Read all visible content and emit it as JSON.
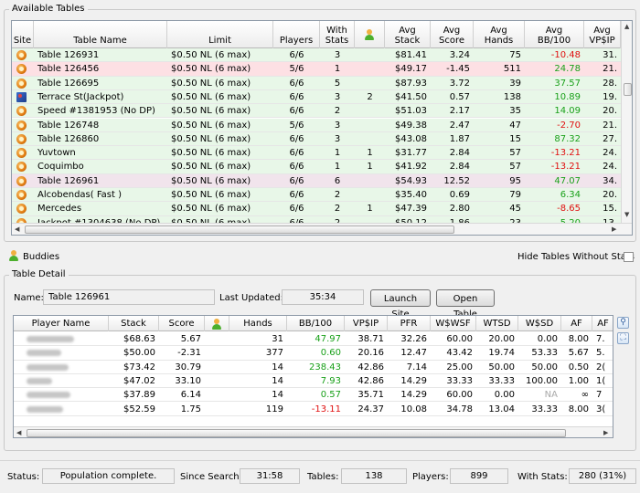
{
  "available_tables": {
    "title": "Available Tables",
    "columns": [
      "Site",
      "Table Name",
      "Limit",
      "Players",
      "With\nStats",
      "",
      "Avg\nStack",
      "Avg\nScore",
      "Avg\nHands",
      "Avg\nBB/100",
      "Avg\nVP$IP"
    ],
    "rows": [
      {
        "site_icon": "site-orange-icon",
        "name": "Table  126931",
        "limit": "$0.50 NL (6 max)",
        "players": "6/6",
        "with_stats": "3",
        "buddies": "",
        "avg_stack": "$81.41",
        "avg_score": "3.24",
        "avg_hands": "75",
        "avg_bb100": "-10.48",
        "bb_color": "red",
        "avg_vpip": "31.",
        "bg": "#e8f7e8"
      },
      {
        "site_icon": "site-orange-icon",
        "name": "Table  126456",
        "limit": "$0.50 NL (6 max)",
        "players": "5/6",
        "with_stats": "1",
        "buddies": "",
        "avg_stack": "$49.17",
        "avg_score": "-1.45",
        "avg_hands": "511",
        "avg_bb100": "24.78",
        "bb_color": "green",
        "avg_vpip": "21.",
        "bg": "#fde0e4"
      },
      {
        "site_icon": "site-orange-icon",
        "name": "Table  126695",
        "limit": "$0.50 NL (6 max)",
        "players": "6/6",
        "with_stats": "5",
        "buddies": "",
        "avg_stack": "$87.93",
        "avg_score": "3.72",
        "avg_hands": "39",
        "avg_bb100": "37.57",
        "bb_color": "green",
        "avg_vpip": "28.",
        "bg": "#e8f7e8"
      },
      {
        "site_icon": "site-blue-icon",
        "name": "Terrace St(Jackpot)",
        "limit": "$0.50 NL (6 max)",
        "players": "6/6",
        "with_stats": "3",
        "buddies": "2",
        "avg_stack": "$41.50",
        "avg_score": "0.57",
        "avg_hands": "138",
        "avg_bb100": "10.89",
        "bb_color": "green",
        "avg_vpip": "19.",
        "bg": "#e8f7e8"
      },
      {
        "site_icon": "site-orange-icon",
        "name": "Speed #1381953 (No DP)",
        "limit": "$0.50 NL (6 max)",
        "players": "6/6",
        "with_stats": "2",
        "buddies": "",
        "avg_stack": "$51.03",
        "avg_score": "2.17",
        "avg_hands": "35",
        "avg_bb100": "14.09",
        "bb_color": "green",
        "avg_vpip": "20.",
        "bg": "#e8f7e8"
      },
      {
        "site_icon": "site-orange-icon",
        "name": "Table  126748",
        "limit": "$0.50 NL (6 max)",
        "players": "5/6",
        "with_stats": "3",
        "buddies": "",
        "avg_stack": "$49.38",
        "avg_score": "2.47",
        "avg_hands": "47",
        "avg_bb100": "-2.70",
        "bb_color": "red",
        "avg_vpip": "21.",
        "bg": "#e8f7e8"
      },
      {
        "site_icon": "site-orange-icon",
        "name": "Table  126860",
        "limit": "$0.50 NL (6 max)",
        "players": "6/6",
        "with_stats": "3",
        "buddies": "",
        "avg_stack": "$43.08",
        "avg_score": "1.87",
        "avg_hands": "15",
        "avg_bb100": "87.32",
        "bb_color": "green",
        "avg_vpip": "27.",
        "bg": "#e8f7e8"
      },
      {
        "site_icon": "site-orange-icon",
        "name": "Yuvtown",
        "limit": "$0.50 NL (6 max)",
        "players": "6/6",
        "with_stats": "1",
        "buddies": "1",
        "avg_stack": "$31.77",
        "avg_score": "2.84",
        "avg_hands": "57",
        "avg_bb100": "-13.21",
        "bb_color": "red",
        "avg_vpip": "24.",
        "bg": "#e8f7e8"
      },
      {
        "site_icon": "site-orange-icon",
        "name": "Coquimbo",
        "limit": "$0.50 NL (6 max)",
        "players": "6/6",
        "with_stats": "1",
        "buddies": "1",
        "avg_stack": "$41.92",
        "avg_score": "2.84",
        "avg_hands": "57",
        "avg_bb100": "-13.21",
        "bb_color": "red",
        "avg_vpip": "24.",
        "bg": "#e8f7e8"
      },
      {
        "site_icon": "site-orange-icon",
        "name": "Table  126961",
        "limit": "$0.50 NL (6 max)",
        "players": "6/6",
        "with_stats": "6",
        "buddies": "",
        "avg_stack": "$54.93",
        "avg_score": "12.52",
        "avg_hands": "95",
        "avg_bb100": "47.07",
        "bb_color": "green",
        "avg_vpip": "34.",
        "bg": "#f1e4ec"
      },
      {
        "site_icon": "site-orange-icon",
        "name": "Alcobendas( Fast )",
        "limit": "$0.50 NL (6 max)",
        "players": "6/6",
        "with_stats": "2",
        "buddies": "",
        "avg_stack": "$35.40",
        "avg_score": "0.69",
        "avg_hands": "79",
        "avg_bb100": "6.34",
        "bb_color": "green",
        "avg_vpip": "20.",
        "bg": "#e8f7e8"
      },
      {
        "site_icon": "site-orange-icon",
        "name": "Mercedes",
        "limit": "$0.50 NL (6 max)",
        "players": "6/6",
        "with_stats": "2",
        "buddies": "1",
        "avg_stack": "$47.39",
        "avg_score": "2.80",
        "avg_hands": "45",
        "avg_bb100": "-8.65",
        "bb_color": "red",
        "avg_vpip": "15.",
        "bg": "#e8f7e8"
      },
      {
        "site_icon": "site-orange-icon",
        "name": "Jackpot #1304638 (No DP)",
        "limit": "$0.50 NL (6 max)",
        "players": "6/6",
        "with_stats": "2",
        "buddies": "",
        "avg_stack": "$50.12",
        "avg_score": "1.86",
        "avg_hands": "23",
        "avg_bb100": "5.20",
        "bb_color": "green",
        "avg_vpip": "13.",
        "bg": "#e8f7e8"
      }
    ]
  },
  "buddies": {
    "label": "Buddies"
  },
  "hide_tables": {
    "label": "Hide Tables Without Stats"
  },
  "table_detail": {
    "title": "Table Detail",
    "name_label": "Name:",
    "name_value": "Table  126961",
    "last_updated_label": "Last Updated:",
    "last_updated_value": "35:34",
    "launch_site": "Launch Site",
    "open_table": "Open Table",
    "columns": [
      "Player Name",
      "Stack",
      "Score",
      "",
      "Hands",
      "BB/100",
      "VP$IP",
      "PFR",
      "W$WSF",
      "WTSD",
      "W$SD",
      "AF",
      "AF"
    ],
    "rows": [
      {
        "stack": "$68.63",
        "score": "5.67",
        "hands": "31",
        "bb100": "47.97",
        "bb_color": "green",
        "vpip": "38.71",
        "pfr": "32.26",
        "wwsf": "60.00",
        "wtsd": "20.00",
        "wsd": "0.00",
        "wsd_color": "",
        "af": "8.00",
        "af2": "7.",
        "blur_w": 52
      },
      {
        "stack": "$50.00",
        "score": "-2.31",
        "hands": "377",
        "bb100": "0.60",
        "bb_color": "green",
        "vpip": "20.16",
        "pfr": "12.47",
        "wwsf": "43.42",
        "wtsd": "19.74",
        "wsd": "53.33",
        "wsd_color": "",
        "af": "5.67",
        "af2": "5.",
        "blur_w": 38
      },
      {
        "stack": "$73.42",
        "score": "30.79",
        "hands": "14",
        "bb100": "238.43",
        "bb_color": "green",
        "vpip": "42.86",
        "pfr": "7.14",
        "wwsf": "25.00",
        "wtsd": "50.00",
        "wsd": "50.00",
        "wsd_color": "",
        "af": "0.50",
        "af2": "2(",
        "blur_w": 46
      },
      {
        "stack": "$47.02",
        "score": "33.10",
        "hands": "14",
        "bb100": "7.93",
        "bb_color": "green",
        "vpip": "42.86",
        "pfr": "14.29",
        "wwsf": "33.33",
        "wtsd": "33.33",
        "wsd": "100.00",
        "wsd_color": "",
        "af": "1.00",
        "af2": "1(",
        "blur_w": 28
      },
      {
        "stack": "$37.89",
        "score": "6.14",
        "hands": "14",
        "bb100": "0.57",
        "bb_color": "green",
        "vpip": "35.71",
        "pfr": "14.29",
        "wwsf": "60.00",
        "wtsd": "0.00",
        "wsd": "NA",
        "wsd_color": "gray",
        "af": "∞",
        "af2": "7",
        "blur_w": 48
      },
      {
        "stack": "$52.59",
        "score": "1.75",
        "hands": "119",
        "bb100": "-13.11",
        "bb_color": "red",
        "vpip": "24.37",
        "pfr": "10.08",
        "wwsf": "34.78",
        "wtsd": "13.04",
        "wsd": "33.33",
        "wsd_color": "",
        "af": "8.00",
        "af2": "3(",
        "blur_w": 40
      }
    ]
  },
  "status_bar": {
    "status_label": "Status:",
    "status_value": "Population complete.",
    "since_search_label": "Since Search:",
    "since_search_value": "31:58",
    "tables_label": "Tables:",
    "tables_value": "138",
    "players_label": "Players:",
    "players_value": "899",
    "with_stats_label": "With Stats:",
    "with_stats_value": "280 (31%)"
  },
  "colors": {
    "green": "#19a019",
    "red": "#e01010",
    "row_green": "#e8f7e8",
    "row_pink": "#fde0e4",
    "row_selected": "#f1e4ec"
  }
}
